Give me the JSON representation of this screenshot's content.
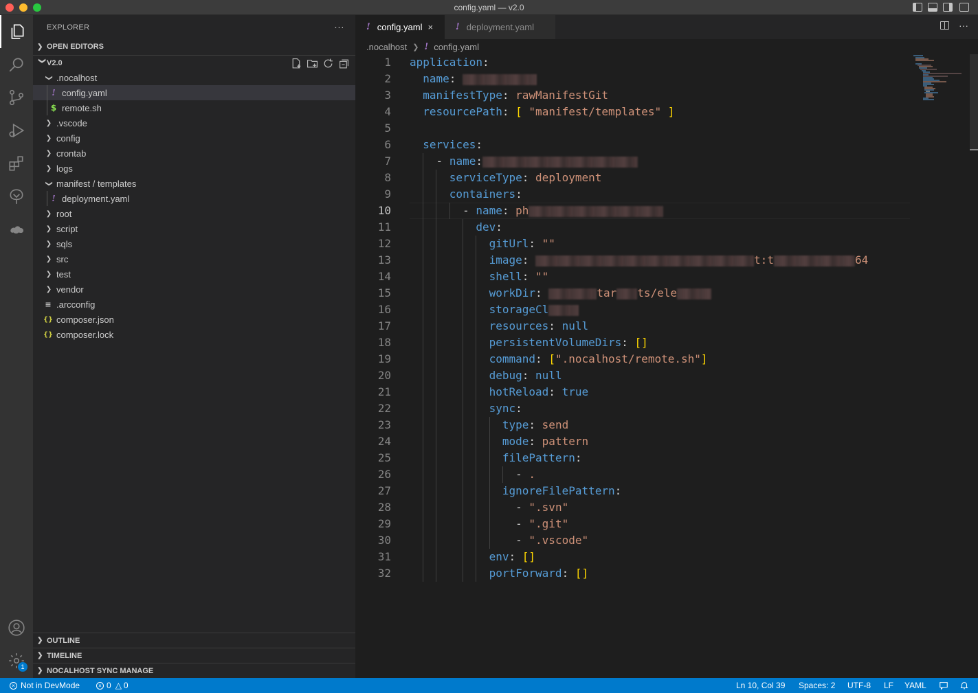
{
  "window": {
    "title": "config.yaml — v2.0"
  },
  "colors": {
    "accent": "#007acc",
    "yaml_icon": "#a074c4",
    "sh_icon": "#89e051",
    "json_icon": "#cbcb41"
  },
  "activity_bar": {
    "items": [
      "explorer-icon",
      "search-icon",
      "source-control-icon",
      "run-debug-icon",
      "extensions-icon",
      "nocalhost-tree-icon",
      "nocalhost-cloud-icon"
    ],
    "bottom": [
      "accounts-icon",
      "manage-gear-icon"
    ],
    "gear_badge": "1"
  },
  "sidebar": {
    "header": "EXPLORER",
    "more": "···",
    "open_editors": "OPEN EDITORS",
    "folder_name": "V2.0",
    "tree": [
      {
        "label": ".nocalhost",
        "kind": "folder-open"
      },
      {
        "label": "config.yaml",
        "kind": "yaml"
      },
      {
        "label": "remote.sh",
        "kind": "sh"
      },
      {
        "label": ".vscode",
        "kind": "folder"
      },
      {
        "label": "config",
        "kind": "folder"
      },
      {
        "label": "crontab",
        "kind": "folder"
      },
      {
        "label": "logs",
        "kind": "folder"
      },
      {
        "label": "manifest / templates",
        "kind": "folder-open"
      },
      {
        "label": "deployment.yaml",
        "kind": "yaml"
      },
      {
        "label": "root",
        "kind": "folder"
      },
      {
        "label": "script",
        "kind": "folder"
      },
      {
        "label": "sqls",
        "kind": "folder"
      },
      {
        "label": "src",
        "kind": "folder"
      },
      {
        "label": "test",
        "kind": "folder"
      },
      {
        "label": "vendor",
        "kind": "folder"
      },
      {
        "label": ".arcconfig",
        "kind": "cfg"
      },
      {
        "label": "composer.json",
        "kind": "json"
      },
      {
        "label": "composer.lock",
        "kind": "json"
      }
    ],
    "outline": "OUTLINE",
    "timeline": "TIMELINE",
    "sync_manage": "NOCALHOST SYNC MANAGE"
  },
  "editor": {
    "tabs": [
      {
        "label": "config.yaml",
        "close": "×"
      },
      {
        "label": "deployment.yaml"
      }
    ],
    "tab_bang": "!",
    "breadcrumb": [
      ".nocalhost",
      "config.yaml"
    ],
    "line_numbers": [
      "1",
      "2",
      "3",
      "4",
      "5",
      "6",
      "7",
      "8",
      "9",
      "10",
      "11",
      "12",
      "13",
      "14",
      "15",
      "16",
      "17",
      "18",
      "19",
      "20",
      "21",
      "22",
      "23",
      "24",
      "25",
      "26",
      "27",
      "28",
      "29",
      "30",
      "31",
      "32"
    ],
    "code": {
      "l1k": "application",
      "colon": ":",
      "l2k": "name",
      "l3k": "manifestType",
      "l3v": "rawManifestGit",
      "l4k": "resourcePath",
      "l4v": "\"manifest/templates\"",
      "l6k": "services",
      "l7k": "name",
      "l8k": "serviceType",
      "l8v": "deployment",
      "l9k": "containers",
      "l10k": "name",
      "l10v": "ph",
      "l11k": "dev",
      "l12k": "gitUrl",
      "l12v": "\"\"",
      "l13k": "image",
      "l13v_mid": "t:t",
      "l13v_end": "64",
      "l14k": "shell",
      "l14v": "\"\"",
      "l15k": "workDir",
      "l15v1": "tar",
      "l15v2": "ts/ele",
      "l16k": "storageCl",
      "l17k": "resources",
      "l17v": "null",
      "l18k": "persistentVolumeDirs",
      "l18v": "[]",
      "l19k": "command",
      "l19v": "\".nocalhost/remote.sh\"",
      "l20k": "debug",
      "l20v": "null",
      "l21k": "hotReload",
      "l21v": "true",
      "l22k": "sync",
      "l23k": "type",
      "l23v": "send",
      "l24k": "mode",
      "l24v": "pattern",
      "l25k": "filePattern",
      "l26v": ".",
      "l27k": "ignoreFilePattern",
      "l28v": "\".svn\"",
      "l29v": "\".git\"",
      "l30v": "\".vscode\"",
      "l31k": "env",
      "l31v": "[]",
      "l32k": "portForward",
      "l32v": "[]",
      "dash": "-"
    }
  },
  "status_bar": {
    "devmode": "Not in DevMode",
    "errors": "0",
    "warnings": "0",
    "cursor": "Ln 10, Col 39",
    "spaces": "Spaces: 2",
    "encoding": "UTF-8",
    "eol": "LF",
    "language": "YAML"
  }
}
